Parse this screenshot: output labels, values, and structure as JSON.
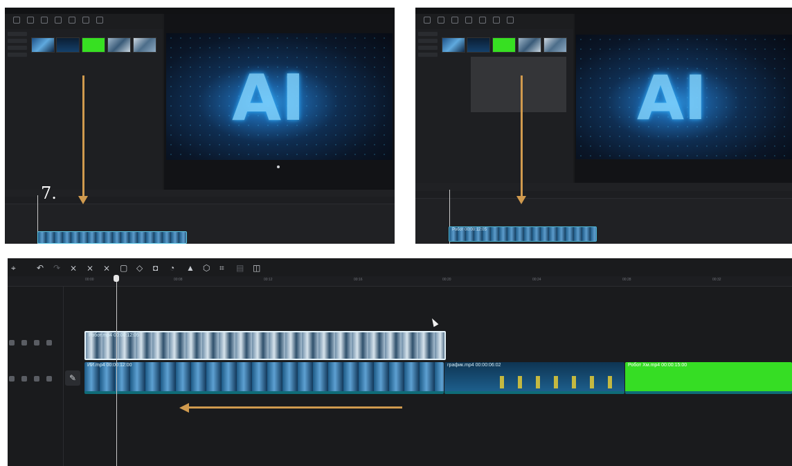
{
  "step_label": "7.",
  "accent_color": "#d09a4e",
  "timeline": {
    "ruler_labels": [
      "00:00",
      "00:08",
      "00:12",
      "00:16",
      "00:20",
      "00:24",
      "00:28",
      "00:32"
    ],
    "top_clip": {
      "label": "Робот.mp4  00:00:12:05"
    },
    "main_clips": [
      {
        "label": "ИИ.mp4  00:00:12:00"
      },
      {
        "label": "график.mp4  00:00:06:02"
      },
      {
        "label": "Робот Хм.mp4  00:00:15:00"
      }
    ]
  },
  "small_panel": {
    "clip_label": "Робот 00:00:12:05"
  }
}
